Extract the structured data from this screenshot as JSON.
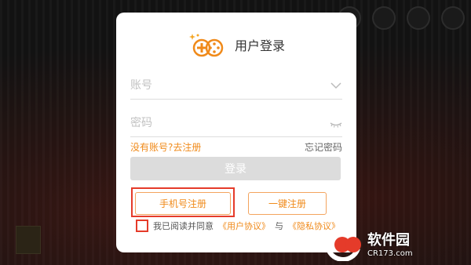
{
  "dialog": {
    "title": "用户登录",
    "account_placeholder": "账号",
    "password_placeholder": "密码",
    "register_link": "没有账号?去注册",
    "forgot_link": "忘记密码",
    "login_button": "登录",
    "phone_register_button": "手机号注册",
    "quick_register_button": "一键注册",
    "agreement": {
      "prefix": "我已阅读并同意",
      "user_agreement": "《用户协议》",
      "conjunction": "与",
      "privacy_policy": "《隐私协议》"
    }
  },
  "watermark": {
    "name": "软件园",
    "url": "CR173.com"
  },
  "colors": {
    "accent": "#f08a1a",
    "highlight": "#e53b2a",
    "button_disabled": "#dcdcdc"
  }
}
